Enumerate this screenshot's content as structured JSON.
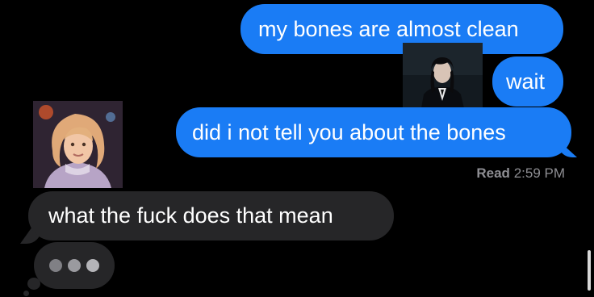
{
  "theme": {
    "background": "#000000",
    "sent_bubble_color": "#1a7cf5",
    "received_bubble_color": "#262628",
    "timestamp_color": "#8e8e93"
  },
  "conversation": {
    "messages": [
      {
        "direction": "sent",
        "text": "my bones are almost clean"
      },
      {
        "direction": "sent",
        "text": "wait"
      },
      {
        "direction": "sent",
        "text": "did i not tell you about the bones"
      },
      {
        "direction": "received",
        "text": "what the fuck does that mean"
      }
    ],
    "read_receipt": {
      "label": "Read",
      "time": "2:59 PM"
    },
    "typing_indicator": {
      "dots": 3
    }
  },
  "avatars": {
    "sender": {
      "icon": "dark-haired-person-avatar-icon"
    },
    "receiver": {
      "icon": "blonde-person-avatar-icon"
    }
  }
}
